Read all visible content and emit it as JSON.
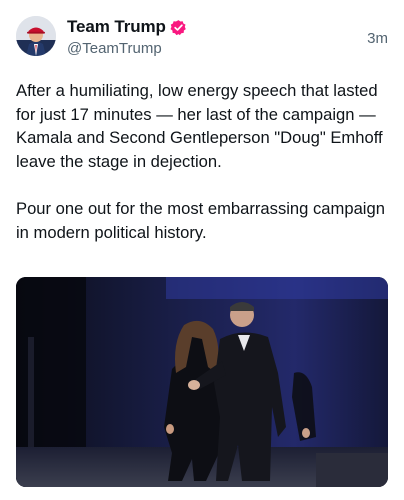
{
  "post": {
    "author": {
      "display_name": "Team Trump",
      "handle": "@TeamTrump",
      "verified": true,
      "avatar_icon": "profile-photo-icon"
    },
    "timestamp": "3m",
    "text": {
      "paragraph_1": "After a humiliating, low energy speech that lasted for just 17 minutes — her last of the campaign — Kamala and Second Gentleperson \"Doug\" Emhoff leave the stage in dejection.",
      "paragraph_2": "Pour one out for the most embarrassing campaign in modern political history."
    },
    "media": {
      "kind": "video",
      "icon": "video-still-icon"
    },
    "colors": {
      "verified_badge": "#f91880",
      "secondary_text": "#536471",
      "primary_text": "#0f1419"
    }
  }
}
